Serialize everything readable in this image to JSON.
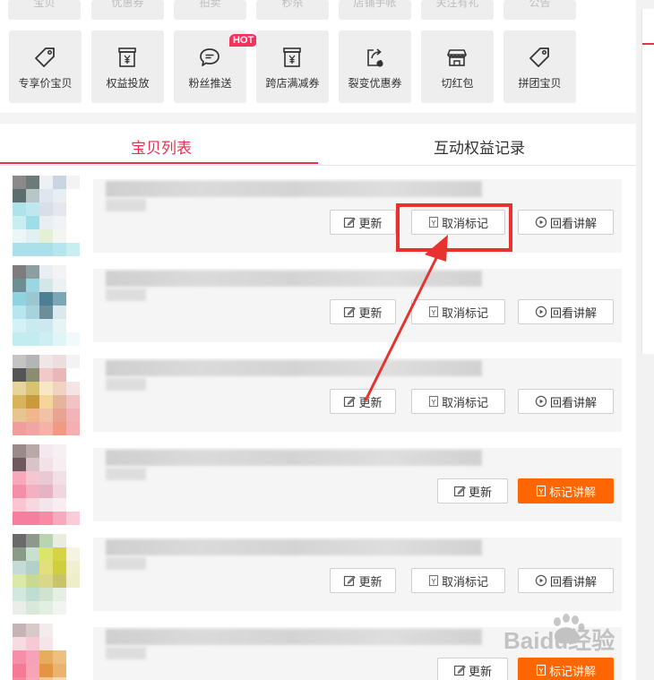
{
  "toolbar": {
    "top_partial": [
      "宝贝",
      "优惠券",
      "拍卖",
      "秒杀",
      "店铺手帐",
      "关注有礼",
      "公告"
    ],
    "items": [
      {
        "label": "专享价宝贝",
        "icon": "tag-icon"
      },
      {
        "label": "权益投放",
        "icon": "yen-box-icon"
      },
      {
        "label": "粉丝推送",
        "icon": "chat-bubble-icon",
        "badge": "HOT"
      },
      {
        "label": "跨店满减券",
        "icon": "yen-box-icon"
      },
      {
        "label": "裂变优惠券",
        "icon": "share-coupon-icon"
      },
      {
        "label": "切红包",
        "icon": "shop-icon"
      },
      {
        "label": "拼团宝贝",
        "icon": "tag-icon"
      }
    ]
  },
  "tabs": [
    {
      "label": "宝贝列表",
      "active": true
    },
    {
      "label": "互动权益记录",
      "active": false
    }
  ],
  "buttons": {
    "update": "更新",
    "unmark": "取消标记",
    "replay": "回看讲解",
    "mark": "标记讲解"
  },
  "rows": [
    {
      "state": "marked"
    },
    {
      "state": "marked"
    },
    {
      "state": "marked"
    },
    {
      "state": "unmarked"
    },
    {
      "state": "marked"
    },
    {
      "state": "unmarked"
    }
  ],
  "watermark": "Baidu经验",
  "colors": {
    "accent": "#e8324f",
    "primary_button": "#ff6600",
    "highlight": "#e8322f"
  }
}
